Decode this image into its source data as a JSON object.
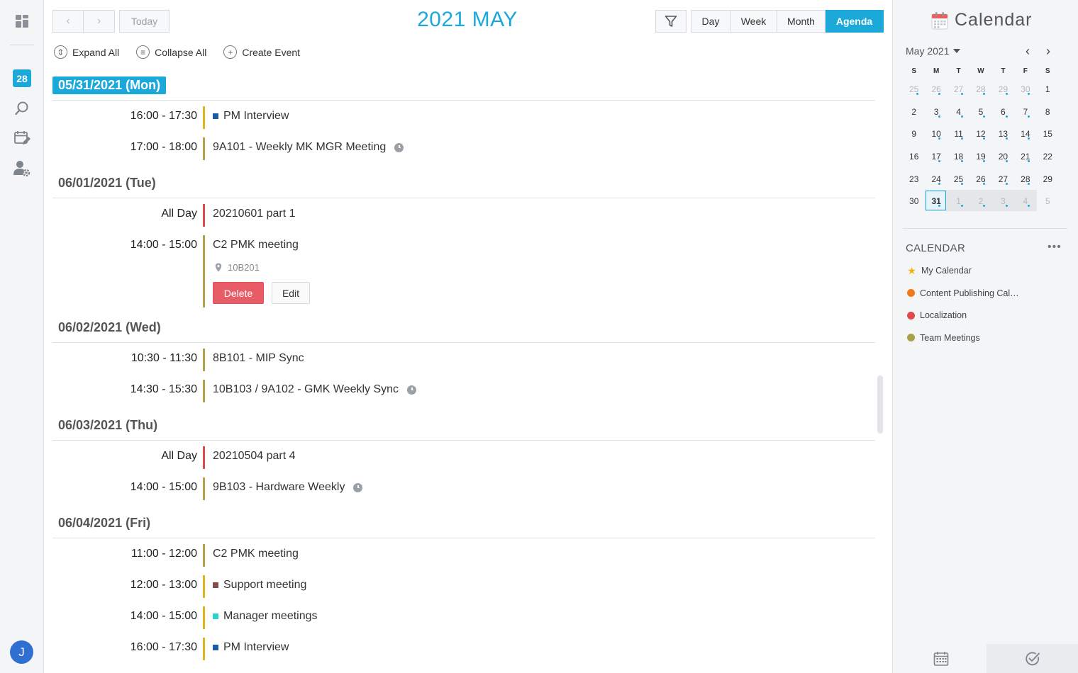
{
  "rail": {
    "date_badge": "28",
    "avatar_initial": "J",
    "icons": [
      "dashboard-icon",
      "search-icon",
      "calendar-edit-icon",
      "user-settings-icon"
    ]
  },
  "toolbar": {
    "today_label": "Today",
    "title": "2021 MAY",
    "views": [
      "Day",
      "Week",
      "Month",
      "Agenda"
    ],
    "active_view": "Agenda",
    "accent": "#1ba9da"
  },
  "actions": {
    "expand_all": "Expand All",
    "collapse_all": "Collapse All",
    "create_event": "Create Event"
  },
  "agenda": {
    "days": [
      {
        "label": "05/31/2021 (Mon)",
        "today": true,
        "events": [
          {
            "time": "16:00 - 17:30",
            "title": "PM Interview",
            "bar": "#e0b51b",
            "square": "#1b5aa8",
            "clock": false
          },
          {
            "time": "17:00 - 18:00",
            "title": "9A101 - Weekly MK MGR Meeting",
            "bar": "#b3a34a",
            "square": "",
            "clock": true
          }
        ]
      },
      {
        "label": "06/01/2021 (Tue)",
        "today": false,
        "events": [
          {
            "time": "All Day",
            "title": "20210601 part 1",
            "bar": "#e04a4a",
            "square": "",
            "clock": false
          },
          {
            "time": "14:00 - 15:00",
            "title": "C2 PMK meeting",
            "bar": "#b3a34a",
            "square": "",
            "clock": false,
            "expanded": true,
            "location": "10B201",
            "delete_label": "Delete",
            "edit_label": "Edit"
          }
        ]
      },
      {
        "label": "06/02/2021 (Wed)",
        "today": false,
        "events": [
          {
            "time": "10:30 - 11:30",
            "title": "8B101 - MIP Sync",
            "bar": "#b3a34a",
            "square": "",
            "clock": false
          },
          {
            "time": "14:30 - 15:30",
            "title": "10B103 / 9A102 - GMK Weekly Sync",
            "bar": "#b3a34a",
            "square": "",
            "clock": true
          }
        ]
      },
      {
        "label": "06/03/2021 (Thu)",
        "today": false,
        "events": [
          {
            "time": "All Day",
            "title": "20210504 part 4",
            "bar": "#e04a4a",
            "square": "",
            "clock": false
          },
          {
            "time": "14:00 - 15:00",
            "title": "9B103 - Hardware Weekly",
            "bar": "#b3a34a",
            "square": "",
            "clock": true
          }
        ]
      },
      {
        "label": "06/04/2021 (Fri)",
        "today": false,
        "events": [
          {
            "time": "11:00 - 12:00",
            "title": "C2 PMK meeting",
            "bar": "#b3a34a",
            "square": "",
            "clock": false
          },
          {
            "time": "12:00 - 13:00",
            "title": "Support meeting",
            "bar": "#e0b51b",
            "square": "#8b4a4a",
            "clock": false
          },
          {
            "time": "14:00 - 15:00",
            "title": "Manager meetings",
            "bar": "#e0b51b",
            "square": "#2bd1d1",
            "clock": false
          },
          {
            "time": "16:00 - 17:30",
            "title": "PM Interview",
            "bar": "#e0b51b",
            "square": "#1b5aa8",
            "clock": false
          }
        ]
      }
    ]
  },
  "side": {
    "brand": "Calendar",
    "month_label": "May 2021",
    "dow": [
      "S",
      "M",
      "T",
      "W",
      "T",
      "F",
      "S"
    ],
    "weeks": [
      [
        [
          "25",
          1,
          1
        ],
        [
          "26",
          1,
          1
        ],
        [
          "27",
          1,
          1
        ],
        [
          "28",
          1,
          1
        ],
        [
          "29",
          1,
          1
        ],
        [
          "30",
          1,
          1
        ],
        [
          "1",
          0,
          0
        ]
      ],
      [
        [
          "2",
          0,
          0
        ],
        [
          "3",
          0,
          1
        ],
        [
          "4",
          0,
          1
        ],
        [
          "5",
          0,
          1
        ],
        [
          "6",
          0,
          1
        ],
        [
          "7",
          0,
          1
        ],
        [
          "8",
          0,
          0
        ]
      ],
      [
        [
          "9",
          0,
          0
        ],
        [
          "10",
          0,
          1
        ],
        [
          "11",
          0,
          1
        ],
        [
          "12",
          0,
          1
        ],
        [
          "13",
          0,
          1
        ],
        [
          "14",
          0,
          1
        ],
        [
          "15",
          0,
          0
        ]
      ],
      [
        [
          "16",
          0,
          0
        ],
        [
          "17",
          0,
          1
        ],
        [
          "18",
          0,
          1
        ],
        [
          "19",
          0,
          1
        ],
        [
          "20",
          0,
          1
        ],
        [
          "21",
          0,
          1
        ],
        [
          "22",
          0,
          0
        ]
      ],
      [
        [
          "23",
          0,
          0
        ],
        [
          "24",
          0,
          1
        ],
        [
          "25",
          0,
          1
        ],
        [
          "26",
          0,
          1
        ],
        [
          "27",
          0,
          1
        ],
        [
          "28",
          0,
          1
        ],
        [
          "29",
          0,
          0
        ]
      ],
      [
        [
          "30",
          0,
          0
        ],
        [
          "31",
          0,
          1
        ],
        [
          "1",
          1,
          1
        ],
        [
          "2",
          1,
          1
        ],
        [
          "3",
          1,
          1
        ],
        [
          "4",
          1,
          1
        ],
        [
          "5",
          1,
          0
        ]
      ]
    ],
    "selected_day": "31",
    "calendar_heading": "CALENDAR",
    "more_label": "•••",
    "calendars": [
      {
        "name": "My Calendar",
        "color": "#f0b400",
        "star": true
      },
      {
        "name": "Content Publishing Cal…",
        "color": "#f07a1a",
        "star": false
      },
      {
        "name": "Localization",
        "color": "#e04a4a",
        "star": false
      },
      {
        "name": "Team Meetings",
        "color": "#a9a04a",
        "star": false
      }
    ]
  }
}
